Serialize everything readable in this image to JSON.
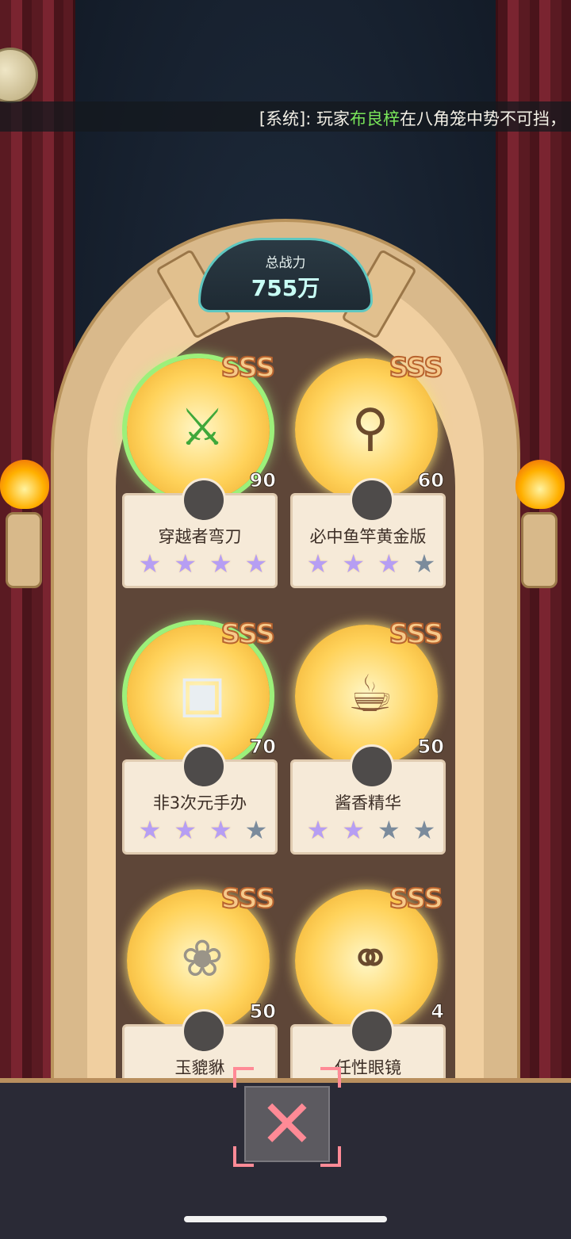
{
  "system_message": {
    "prefix": "[系统]: 玩家",
    "player": "布良梓",
    "text": "在八角笼中势不可挡，"
  },
  "power": {
    "label": "总战力",
    "value": "755万"
  },
  "items": [
    {
      "name": "穿越者弯刀",
      "grade": "SSS",
      "count": "90",
      "stars_on": 4,
      "stars_total": 4,
      "icon": "green-scythes-icon"
    },
    {
      "name": "必中鱼竿黄金版",
      "grade": "SSS",
      "count": "60",
      "stars_on": 3,
      "stars_total": 4,
      "icon": "fishing-rod-icon"
    },
    {
      "name": "非3次元手办",
      "grade": "SSS",
      "count": "70",
      "stars_on": 3,
      "stars_total": 4,
      "icon": "figurine-box-icon"
    },
    {
      "name": "酱香精华",
      "grade": "SSS",
      "count": "50",
      "stars_on": 2,
      "stars_total": 4,
      "icon": "drink-cup-icon"
    },
    {
      "name": "玉貔貅",
      "grade": "SSS",
      "count": "50",
      "icon": "pixiu-statue-icon"
    },
    {
      "name": "任性眼镜",
      "grade": "SSS",
      "count": "4",
      "icon": "sunglasses-cash-icon"
    }
  ],
  "close_label": "✕"
}
